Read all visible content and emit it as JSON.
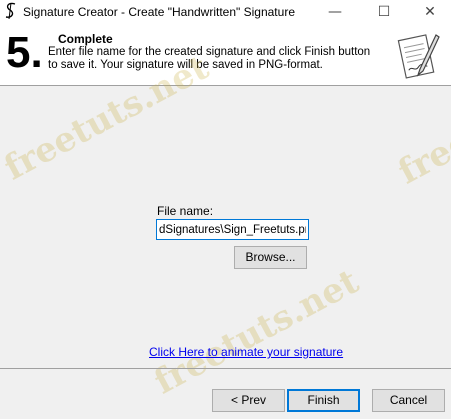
{
  "window": {
    "title": "Signature Creator - Create \"Handwritten\" Signature",
    "icon": "signature-s-icon",
    "controls": {
      "minimize": "—",
      "maximize": "☐",
      "close": "✕"
    }
  },
  "header": {
    "step_number": "5.",
    "step_title": "Complete",
    "description": "Enter file name for the created signature and click Finish button to save it. Your signature will be saved in PNG-format.",
    "image_icon": "document-pen-icon"
  },
  "form": {
    "file_label": "File name:",
    "file_value": "dSignatures\\Sign_Freetuts.png",
    "browse_label": "Browse..."
  },
  "link": {
    "animate_label": "Click Here to animate your signature"
  },
  "footer": {
    "prev_label": "< Prev",
    "finish_label": "Finish",
    "cancel_label": "Cancel"
  },
  "watermark": {
    "text": "freetuts.net",
    "color": "#c8af46"
  },
  "colors": {
    "focus": "#0078d7",
    "link": "#0000ee",
    "dialog_bg": "#f0f0f0"
  }
}
